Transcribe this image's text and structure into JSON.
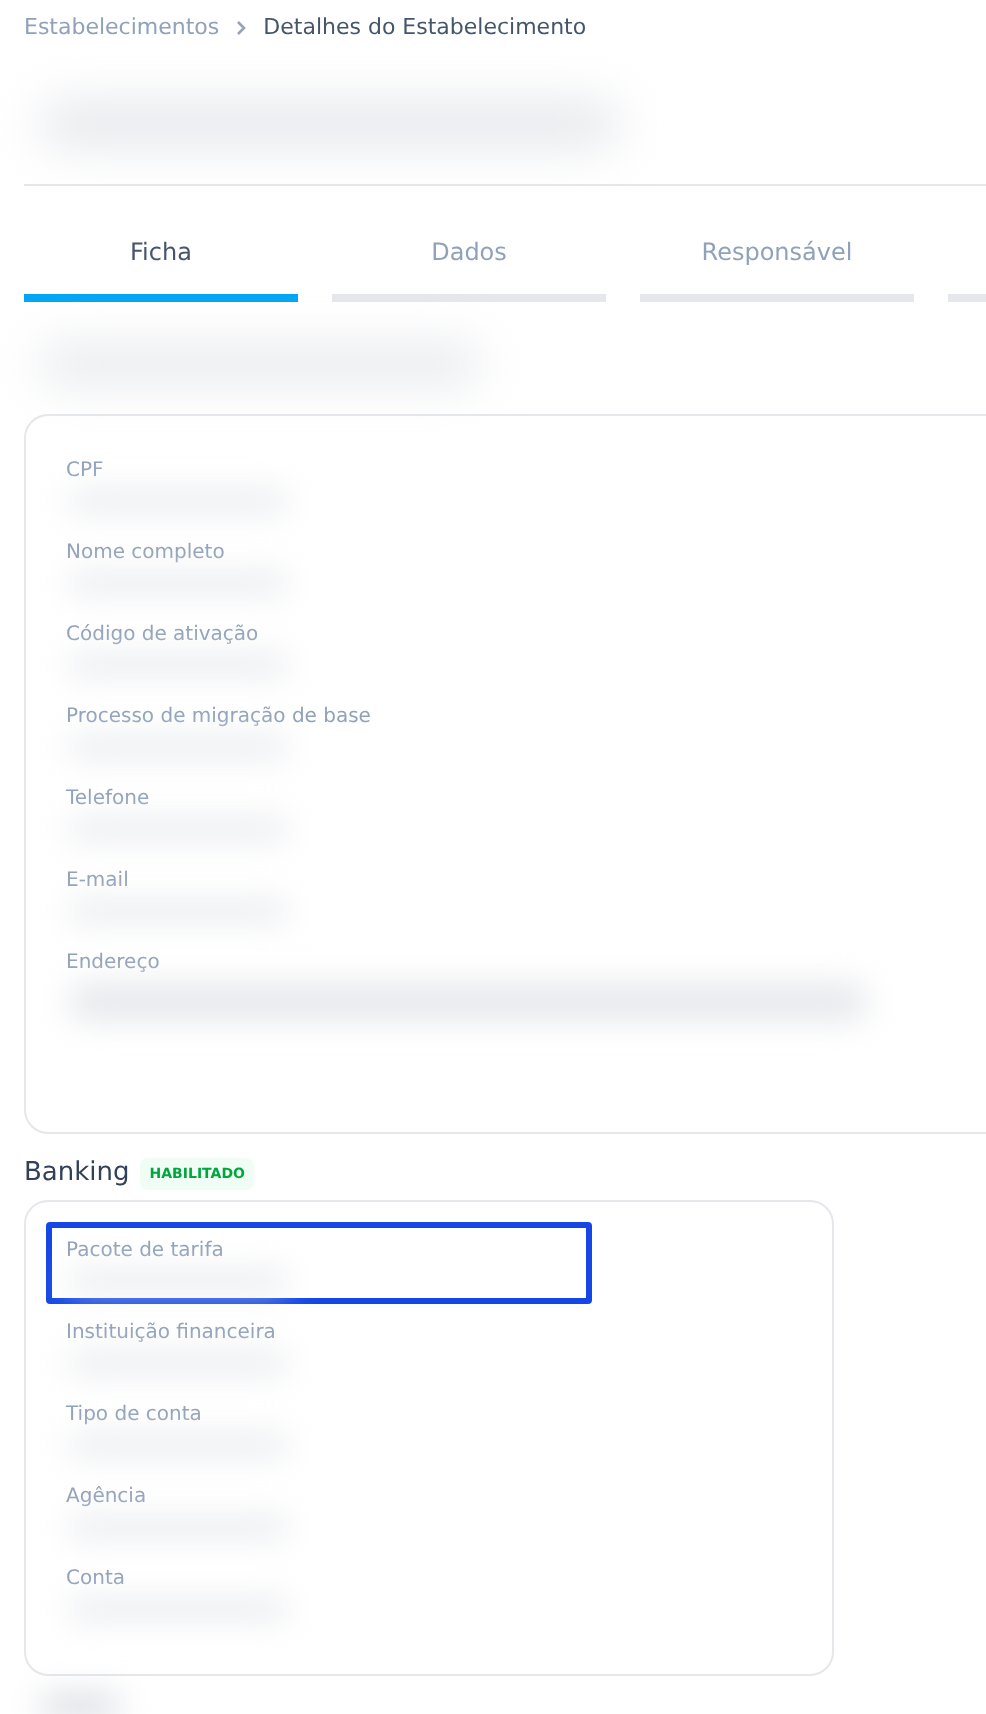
{
  "breadcrumb": [
    {
      "label": "Estabelecimentos",
      "current": false
    },
    {
      "label": "Detalhes do Estabelecimento",
      "current": true
    }
  ],
  "tabs": [
    {
      "label": "Ficha",
      "selected": true
    },
    {
      "label": "Dados",
      "selected": false
    },
    {
      "label": "Responsável",
      "selected": false
    }
  ],
  "details_card": {
    "fields": [
      {
        "label": "CPF",
        "redacted": true,
        "highlighted": false
      },
      {
        "label": "Nome completo",
        "redacted": true,
        "highlighted": false
      },
      {
        "label": "Código de ativação",
        "redacted": true,
        "highlighted": false
      },
      {
        "label": "Processo de migração de base",
        "redacted": true,
        "highlighted": false
      },
      {
        "label": "Telefone",
        "redacted": true,
        "highlighted": false
      },
      {
        "label": "E-mail",
        "redacted": true,
        "highlighted": false
      },
      {
        "label": "Endereço",
        "redacted": true,
        "highlighted": false,
        "kind": "multiline"
      }
    ]
  },
  "banking": {
    "title": "Banking",
    "badge": "HABILITADO",
    "fields": [
      {
        "label": "Pacote de tarifa",
        "redacted": true,
        "highlighted": true
      },
      {
        "label": "Instituição financeira",
        "redacted": true,
        "highlighted": false
      },
      {
        "label": "Tipo de conta",
        "redacted": true,
        "highlighted": false
      },
      {
        "label": "Agência",
        "redacted": true,
        "highlighted": false
      },
      {
        "label": "Conta",
        "redacted": true,
        "highlighted": false
      }
    ]
  }
}
